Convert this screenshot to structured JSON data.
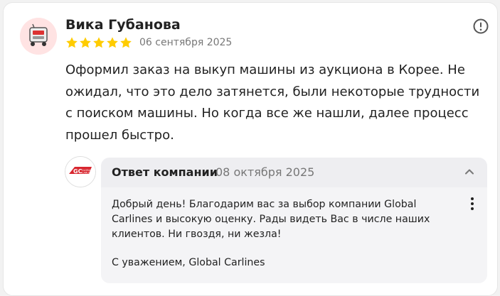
{
  "review": {
    "author": "Вика Губанова",
    "rating": 5,
    "date": "06 сентября 2025",
    "text": "Оформил заказ на выкуп машины из аукциона в Корее. Не ожидал, что это дело затянется, были некоторые трудности с поиском машины. Но когда все же нашли, далее процесс прошел быстро."
  },
  "company": {
    "logo_text": "GC GLOBAL CARLINES"
  },
  "reply": {
    "title": "Ответ компании",
    "date": "08 октября 2025",
    "text": "Добрый день! Благодарим вас за выбор компании Global Carlines и высокую оценку. Рады видеть Вас в числе наших клиентов. Ни гвоздя, ни жезла!",
    "signature": "С уважением, Global Carlines"
  },
  "colors": {
    "star": "#fc0",
    "accent_logo": "#d8262f"
  },
  "icons": {
    "report": "exclamation-circle-icon",
    "collapse": "chevron-up-icon",
    "menu": "vertical-dots-icon"
  }
}
